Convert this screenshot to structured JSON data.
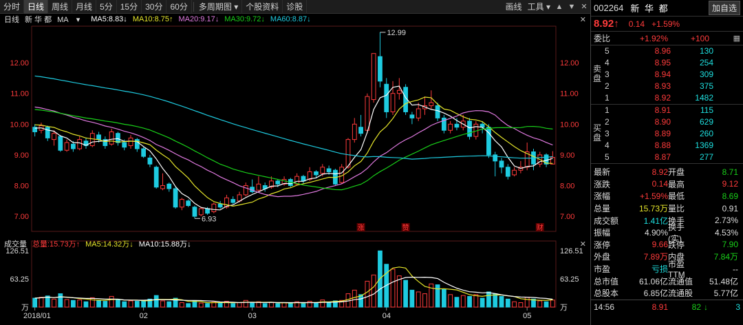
{
  "toolbar": {
    "tabs": [
      "分时",
      "日线",
      "周线",
      "月线",
      "5分",
      "15分",
      "30分",
      "60分"
    ],
    "active_tab": 1,
    "multi_period": "多周期图",
    "dropdown_arrow": "▾",
    "stock_info": "个股资料",
    "diagnose": "诊股",
    "draw": "画线",
    "tools": "工具",
    "tools_arrow": "▾",
    "icons": [
      "up-arrow-icon",
      "down-arrow-icon",
      "close-icon"
    ]
  },
  "ma_legend": {
    "period": "日线",
    "name": "新 华 都",
    "type": "MA",
    "type_arrow": "▾",
    "ma5": "MA5:8.83↓",
    "ma10": "MA10:8.75↑",
    "ma20": "MA20:9.17↓",
    "ma30": "MA30:9.72↓",
    "ma60": "MA60:8.87↓",
    "colors": {
      "ma5": "#ffffff",
      "ma10": "#e6e62a",
      "ma20": "#e07ae0",
      "ma30": "#19d019",
      "ma60": "#1ecbe0"
    }
  },
  "vol_legend": {
    "name": "成交量",
    "total": "总量:15.73万↑",
    "ma5": "MA5:14.32万↓",
    "ma10": "MA10:15.88万↓"
  },
  "chart_data": {
    "type": "candlestick",
    "price_ticks": [
      "12.00",
      "11.00",
      "10.00",
      "9.00",
      "8.00",
      "7.00"
    ],
    "price_range": [
      6.6,
      13.1
    ],
    "vol_ticks": [
      "126.51",
      "63.25",
      "万"
    ],
    "vol_max": 126.51,
    "x_labels": [
      "2018/01",
      "02",
      "03",
      "04",
      "05"
    ],
    "high_annotation": "12.99",
    "low_annotation": "6.93",
    "markers": [
      "涨",
      "赞",
      "财"
    ],
    "candles": [
      {
        "o": 9.9,
        "c": 9.75,
        "h": 10.0,
        "l": 9.6,
        "v": 20
      },
      {
        "o": 9.8,
        "c": 9.95,
        "h": 10.05,
        "l": 9.7,
        "v": 22
      },
      {
        "o": 9.9,
        "c": 9.55,
        "h": 9.95,
        "l": 9.45,
        "v": 25
      },
      {
        "o": 9.5,
        "c": 9.7,
        "h": 9.8,
        "l": 9.3,
        "v": 18
      },
      {
        "o": 9.6,
        "c": 9.15,
        "h": 9.65,
        "l": 9.1,
        "v": 30
      },
      {
        "o": 9.15,
        "c": 9.4,
        "h": 9.5,
        "l": 9.1,
        "v": 17
      },
      {
        "o": 9.35,
        "c": 9.2,
        "h": 9.45,
        "l": 9.1,
        "v": 15
      },
      {
        "o": 9.2,
        "c": 9.5,
        "h": 9.6,
        "l": 9.15,
        "v": 16
      },
      {
        "o": 9.45,
        "c": 9.3,
        "h": 9.55,
        "l": 9.2,
        "v": 12
      },
      {
        "o": 9.3,
        "c": 9.7,
        "h": 9.8,
        "l": 9.25,
        "v": 21
      },
      {
        "o": 9.65,
        "c": 9.5,
        "h": 9.75,
        "l": 9.4,
        "v": 14
      },
      {
        "o": 9.5,
        "c": 9.3,
        "h": 9.6,
        "l": 9.2,
        "v": 13
      },
      {
        "o": 9.35,
        "c": 9.75,
        "h": 9.85,
        "l": 9.3,
        "v": 24
      },
      {
        "o": 9.7,
        "c": 9.4,
        "h": 9.75,
        "l": 9.3,
        "v": 16
      },
      {
        "o": 9.4,
        "c": 9.25,
        "h": 9.5,
        "l": 9.15,
        "v": 12
      },
      {
        "o": 9.3,
        "c": 9.55,
        "h": 9.65,
        "l": 9.2,
        "v": 14
      },
      {
        "o": 9.5,
        "c": 9.2,
        "h": 9.55,
        "l": 9.1,
        "v": 13
      },
      {
        "o": 9.2,
        "c": 8.95,
        "h": 9.25,
        "l": 8.9,
        "v": 15
      },
      {
        "o": 8.9,
        "c": 8.7,
        "h": 9.0,
        "l": 8.6,
        "v": 18
      },
      {
        "o": 8.6,
        "c": 7.95,
        "h": 8.65,
        "l": 7.9,
        "v": 26
      },
      {
        "o": 7.9,
        "c": 8.0,
        "h": 8.4,
        "l": 7.85,
        "v": 14
      },
      {
        "o": 8.05,
        "c": 7.9,
        "h": 8.1,
        "l": 7.8,
        "v": 12
      },
      {
        "o": 7.9,
        "c": 7.3,
        "h": 7.95,
        "l": 7.25,
        "v": 20
      },
      {
        "o": 7.3,
        "c": 7.55,
        "h": 7.6,
        "l": 7.2,
        "v": 10
      },
      {
        "o": 7.5,
        "c": 7.35,
        "h": 7.55,
        "l": 7.3,
        "v": 8
      },
      {
        "o": 7.3,
        "c": 7.0,
        "h": 7.35,
        "l": 6.93,
        "v": 14
      },
      {
        "o": 7.05,
        "c": 7.25,
        "h": 7.3,
        "l": 7.0,
        "v": 9
      },
      {
        "o": 7.25,
        "c": 7.1,
        "h": 7.3,
        "l": 7.05,
        "v": 8
      },
      {
        "o": 7.15,
        "c": 7.4,
        "h": 7.45,
        "l": 7.1,
        "v": 11
      },
      {
        "o": 7.4,
        "c": 7.3,
        "h": 7.5,
        "l": 7.25,
        "v": 9
      },
      {
        "o": 7.3,
        "c": 7.6,
        "h": 7.7,
        "l": 7.25,
        "v": 13
      },
      {
        "o": 7.55,
        "c": 7.45,
        "h": 7.65,
        "l": 7.4,
        "v": 8
      },
      {
        "o": 7.5,
        "c": 7.7,
        "h": 7.8,
        "l": 7.45,
        "v": 10
      },
      {
        "o": 7.7,
        "c": 8.0,
        "h": 8.1,
        "l": 7.65,
        "v": 15
      },
      {
        "o": 7.95,
        "c": 7.8,
        "h": 8.2,
        "l": 7.75,
        "v": 9
      },
      {
        "o": 7.85,
        "c": 8.05,
        "h": 8.3,
        "l": 7.8,
        "v": 12
      },
      {
        "o": 8.0,
        "c": 7.9,
        "h": 8.1,
        "l": 7.8,
        "v": 8
      },
      {
        "o": 7.95,
        "c": 8.15,
        "h": 8.3,
        "l": 7.9,
        "v": 11
      },
      {
        "o": 8.15,
        "c": 8.05,
        "h": 8.2,
        "l": 7.95,
        "v": 8
      },
      {
        "o": 8.05,
        "c": 8.2,
        "h": 8.3,
        "l": 8.0,
        "v": 10
      },
      {
        "o": 8.2,
        "c": 8.0,
        "h": 8.25,
        "l": 7.95,
        "v": 9
      },
      {
        "o": 8.05,
        "c": 8.3,
        "h": 8.4,
        "l": 8.0,
        "v": 12
      },
      {
        "o": 8.3,
        "c": 8.15,
        "h": 8.35,
        "l": 8.05,
        "v": 8
      },
      {
        "o": 8.2,
        "c": 8.45,
        "h": 8.6,
        "l": 8.15,
        "v": 13
      },
      {
        "o": 8.45,
        "c": 8.35,
        "h": 8.5,
        "l": 8.25,
        "v": 10
      },
      {
        "o": 8.4,
        "c": 8.6,
        "h": 8.7,
        "l": 8.3,
        "v": 16
      },
      {
        "o": 8.55,
        "c": 8.45,
        "h": 8.65,
        "l": 8.35,
        "v": 11
      },
      {
        "o": 8.5,
        "c": 8.05,
        "h": 8.55,
        "l": 8.0,
        "v": 14
      },
      {
        "o": 8.1,
        "c": 8.6,
        "h": 8.7,
        "l": 8.05,
        "v": 15
      },
      {
        "o": 8.6,
        "c": 9.5,
        "h": 9.55,
        "l": 8.55,
        "v": 30
      },
      {
        "o": 9.5,
        "c": 10.0,
        "h": 10.2,
        "l": 9.4,
        "v": 38
      },
      {
        "o": 9.9,
        "c": 9.7,
        "h": 10.3,
        "l": 9.6,
        "v": 28
      },
      {
        "o": 9.8,
        "c": 10.9,
        "h": 11.0,
        "l": 9.7,
        "v": 58
      },
      {
        "o": 10.8,
        "c": 12.3,
        "h": 12.3,
        "l": 10.7,
        "v": 72
      },
      {
        "o": 12.2,
        "c": 11.4,
        "h": 12.99,
        "l": 11.2,
        "v": 126
      },
      {
        "o": 11.3,
        "c": 10.4,
        "h": 11.5,
        "l": 10.2,
        "v": 96
      },
      {
        "o": 10.4,
        "c": 11.0,
        "h": 11.4,
        "l": 10.3,
        "v": 85
      },
      {
        "o": 11.0,
        "c": 11.1,
        "h": 11.5,
        "l": 10.8,
        "v": 70
      },
      {
        "o": 11.2,
        "c": 10.4,
        "h": 11.3,
        "l": 10.3,
        "v": 60
      },
      {
        "o": 10.3,
        "c": 10.2,
        "h": 10.4,
        "l": 10.0,
        "v": 38
      },
      {
        "o": 10.2,
        "c": 10.5,
        "h": 10.7,
        "l": 10.1,
        "v": 34
      },
      {
        "o": 10.5,
        "c": 10.6,
        "h": 10.9,
        "l": 10.3,
        "v": 30
      },
      {
        "o": 10.6,
        "c": 10.7,
        "h": 11.1,
        "l": 10.5,
        "v": 52
      },
      {
        "o": 10.6,
        "c": 10.2,
        "h": 10.7,
        "l": 10.1,
        "v": 50
      },
      {
        "o": 10.2,
        "c": 9.8,
        "h": 10.3,
        "l": 9.7,
        "v": 40
      },
      {
        "o": 9.8,
        "c": 10.0,
        "h": 10.1,
        "l": 9.7,
        "v": 28
      },
      {
        "o": 10.0,
        "c": 9.9,
        "h": 10.2,
        "l": 9.8,
        "v": 22
      },
      {
        "o": 9.9,
        "c": 10.1,
        "h": 10.3,
        "l": 9.8,
        "v": 26
      },
      {
        "o": 10.1,
        "c": 9.6,
        "h": 10.2,
        "l": 9.5,
        "v": 24
      },
      {
        "o": 9.6,
        "c": 10.0,
        "h": 10.1,
        "l": 9.5,
        "v": 28
      },
      {
        "o": 10.0,
        "c": 9.9,
        "h": 10.1,
        "l": 9.7,
        "v": 20
      },
      {
        "o": 9.9,
        "c": 9.0,
        "h": 10.0,
        "l": 8.9,
        "v": 34
      },
      {
        "o": 9.0,
        "c": 8.8,
        "h": 9.1,
        "l": 8.3,
        "v": 30
      },
      {
        "o": 8.8,
        "c": 8.6,
        "h": 8.9,
        "l": 8.4,
        "v": 24
      },
      {
        "o": 8.6,
        "c": 8.3,
        "h": 8.7,
        "l": 8.2,
        "v": 18
      },
      {
        "o": 8.35,
        "c": 8.5,
        "h": 8.6,
        "l": 8.3,
        "v": 12
      },
      {
        "o": 8.5,
        "c": 8.6,
        "h": 8.8,
        "l": 8.4,
        "v": 10
      },
      {
        "o": 8.6,
        "c": 9.1,
        "h": 9.4,
        "l": 8.5,
        "v": 22
      },
      {
        "o": 9.1,
        "c": 8.7,
        "h": 9.2,
        "l": 8.5,
        "v": 18
      },
      {
        "o": 8.7,
        "c": 9.0,
        "h": 9.1,
        "l": 8.6,
        "v": 14
      },
      {
        "o": 9.0,
        "c": 8.7,
        "h": 9.05,
        "l": 8.6,
        "v": 12
      },
      {
        "o": 8.7,
        "c": 8.92,
        "h": 9.12,
        "l": 8.69,
        "v": 15.73
      }
    ]
  },
  "panel": {
    "code": "002264",
    "name": "新 华 都",
    "add_watch": "加自选",
    "price": "8.92",
    "arrow": "↑",
    "change": "0.14",
    "pct": "+1.59%",
    "wb_label": "委比",
    "wb_value": "+1.92%",
    "wb_diff": "+100",
    "sell_label": "卖盘",
    "buy_label": "买盘",
    "sells": [
      {
        "lv": "5",
        "pr": "8.96",
        "qt": "130"
      },
      {
        "lv": "4",
        "pr": "8.95",
        "qt": "254"
      },
      {
        "lv": "3",
        "pr": "8.94",
        "qt": "309"
      },
      {
        "lv": "2",
        "pr": "8.93",
        "qt": "375"
      },
      {
        "lv": "1",
        "pr": "8.92",
        "qt": "1482"
      }
    ],
    "buys": [
      {
        "lv": "1",
        "pr": "8.91",
        "qt": "115"
      },
      {
        "lv": "2",
        "pr": "8.90",
        "qt": "629"
      },
      {
        "lv": "3",
        "pr": "8.89",
        "qt": "260"
      },
      {
        "lv": "4",
        "pr": "8.88",
        "qt": "1369"
      },
      {
        "lv": "5",
        "pr": "8.87",
        "qt": "277"
      }
    ],
    "stats": [
      {
        "k1": "最新",
        "v1": "8.92",
        "c1": "red",
        "k2": "开盘",
        "v2": "8.71",
        "c2": "green"
      },
      {
        "k1": "涨跌",
        "v1": "0.14",
        "c1": "red",
        "k2": "最高",
        "v2": "9.12",
        "c2": "red"
      },
      {
        "k1": "涨幅",
        "v1": "+1.59%",
        "c1": "red",
        "k2": "最低",
        "v2": "8.69",
        "c2": "green"
      },
      {
        "k1": "总量",
        "v1": "15.73万",
        "c1": "yellow",
        "k2": "量比",
        "v2": "0.91",
        "c2": "white"
      },
      {
        "k1": "成交额",
        "v1": "1.41亿",
        "c1": "cyan",
        "k2": "换手",
        "v2": "2.73%",
        "c2": "white"
      },
      {
        "k1": "振幅",
        "v1": "4.90%",
        "c1": "white",
        "k2": "换手(实)",
        "v2": "4.53%",
        "c2": "white"
      },
      {
        "k1": "涨停",
        "v1": "9.66",
        "c1": "red",
        "k2": "跌停",
        "v2": "7.90",
        "c2": "green"
      },
      {
        "k1": "外盘",
        "v1": "7.89万",
        "c1": "red",
        "k2": "内盘",
        "v2": "7.84万",
        "c2": "green"
      },
      {
        "k1": "市盈",
        "v1": "亏损",
        "c1": "cyan",
        "k2": "市盈TTM",
        "v2": "--",
        "c2": "white"
      },
      {
        "k1": "总市值",
        "v1": "61.06亿",
        "c1": "white",
        "k2": "流通值",
        "v2": "51.48亿",
        "c2": "white"
      },
      {
        "k1": "总股本",
        "v1": "6.85亿",
        "c1": "white",
        "k2": "流通股",
        "v2": "5.77亿",
        "c2": "white"
      }
    ],
    "tick": {
      "time": "14:56",
      "price": "8.91",
      "vol": "82",
      "arrow": "↓",
      "n": "3"
    }
  }
}
